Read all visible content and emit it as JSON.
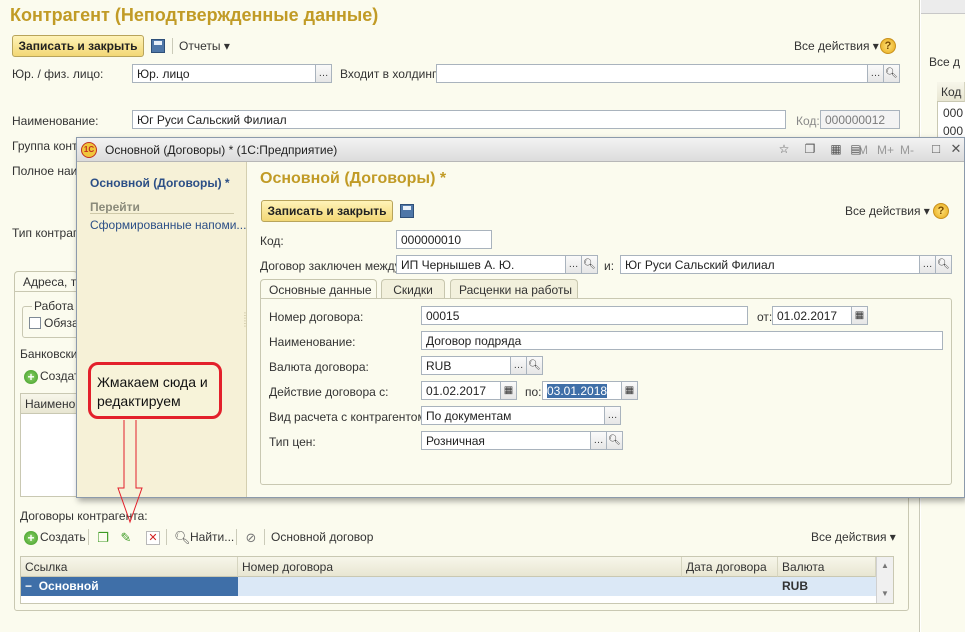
{
  "back_form": {
    "title": "Контрагент (Неподтвержденные данные)",
    "save_close": "Записать и закрыть",
    "reports": "Отчеты ▾",
    "all_actions": "Все действия ▾",
    "help": "?",
    "legal_label": "Юр. / физ. лицо:",
    "legal_value": "Юр. лицо",
    "holding_label": "Входит в холдинг:",
    "holding_value": "",
    "name_label": "Наименование:",
    "name_value": "Юг Руси Сальский Филиал",
    "code_label": "Код:",
    "code_value": "000000012",
    "group_label": "Группа контр",
    "fullname_label": "Полное наим",
    "type_label": "Тип контраг",
    "tab_addresses": "Адреса, те",
    "work_group_label": "Работа",
    "required_label": "Обяза",
    "bank_label": "Банковски",
    "create_label": "Создат",
    "name_column": "Наимено",
    "contracts_label": "Договоры контрагента:",
    "toolbar": {
      "create": "Создать",
      "find": "Найти...",
      "main_contract": "Основной договор",
      "all_actions": "Все действия ▾"
    },
    "grid": {
      "headers": [
        "Ссылка",
        "Номер договора",
        "Дата договора",
        "Валюта"
      ],
      "rows": [
        {
          "link": "Основной",
          "number": "",
          "date": "",
          "currency": "RUB"
        }
      ]
    }
  },
  "right_window": {
    "all_actions_partial": "Все д",
    "code_header": "Код",
    "row1": "000",
    "row2": "000"
  },
  "front_window": {
    "window_title": "Основной (Договоры) * (1С:Предприятие)",
    "title_toolbar": {
      "m": "M",
      "m_plus": "M+",
      "m_minus": "M-"
    },
    "sidebar": {
      "active_item": "Основной (Договоры) *",
      "goto_label": "Перейти",
      "link": "Сформированные напоми..."
    },
    "form_title": "Основной (Договоры) *",
    "save_close": "Записать и закрыть",
    "all_actions": "Все действия ▾",
    "help": "?",
    "code_label": "Код:",
    "code_value": "000000010",
    "between_label": "Договор заключен между:",
    "party1": "ИП Чернышев А. Ю.",
    "and_label": "и:",
    "party2": "Юг Руси Сальский Филиал",
    "tabs": [
      "Основные данные",
      "Скидки",
      "Расценки на работы"
    ],
    "fields": {
      "number_label": "Номер договора:",
      "number_value": "00015",
      "from_label": "от:",
      "from_value": "01.02.2017",
      "name_label": "Наименование:",
      "name_value": "Договор подряда",
      "currency_label": "Валюта договора:",
      "currency_value": "RUB",
      "validity_label": "Действие договора с:",
      "validity_from": "01.02.2017",
      "validity_to_label": "по:",
      "validity_to": "03.01.2018",
      "payment_label": "Вид расчета с контрагентом:",
      "payment_value": "По документам",
      "price_label": "Тип цен:",
      "price_value": "Розничная"
    }
  },
  "annotation": {
    "text": "Жмакаем сюда и редактируем",
    "color": "#e3202b"
  },
  "colors": {
    "title_gold": "#c19b26",
    "selection_blue": "#3f6fa8",
    "row_highlight": "#dbe8f6"
  }
}
